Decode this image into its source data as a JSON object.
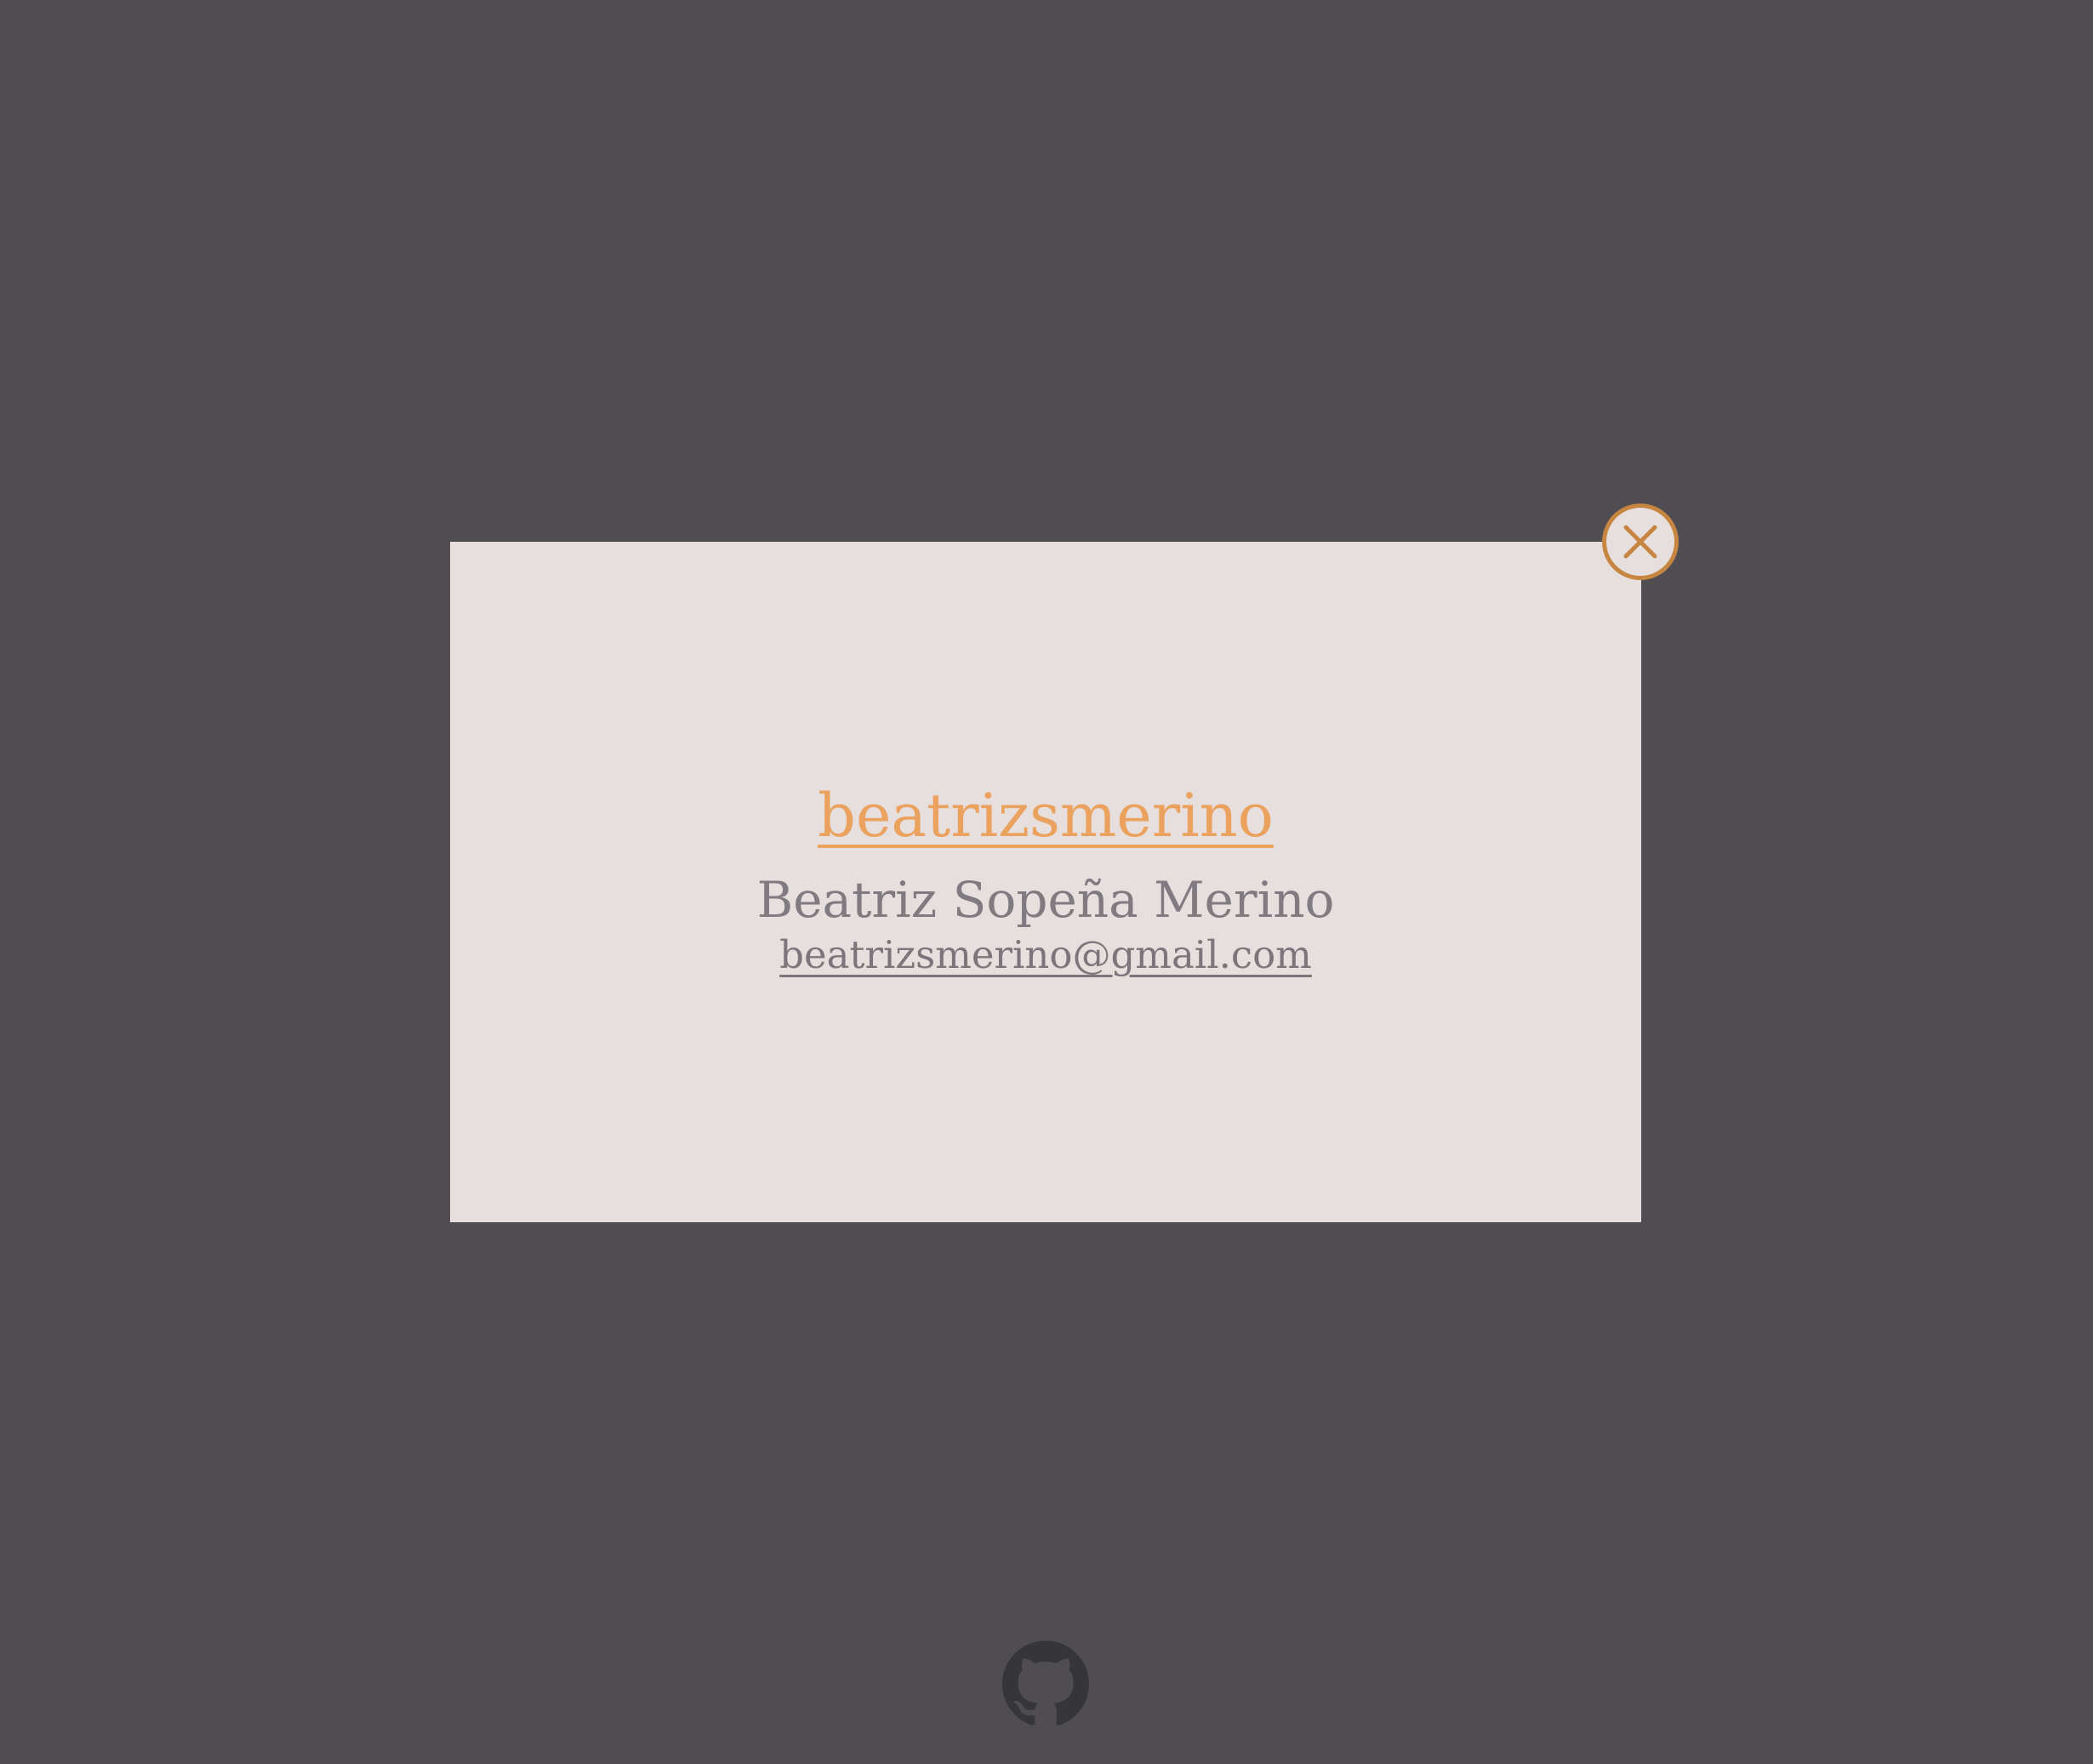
{
  "modal": {
    "username": "beatrizsmerino",
    "full_name": "Beatriz Sopeña Merino",
    "email": "beatrizsmerino@gmail.com"
  },
  "icons": {
    "close": "close-icon",
    "github": "github-icon"
  },
  "colors": {
    "background": "#4f4d51",
    "modal_background": "#e7dfde",
    "accent": "#eba25f",
    "close_border": "#c68642",
    "text_muted": "#807b80",
    "github_icon": "#363538"
  }
}
